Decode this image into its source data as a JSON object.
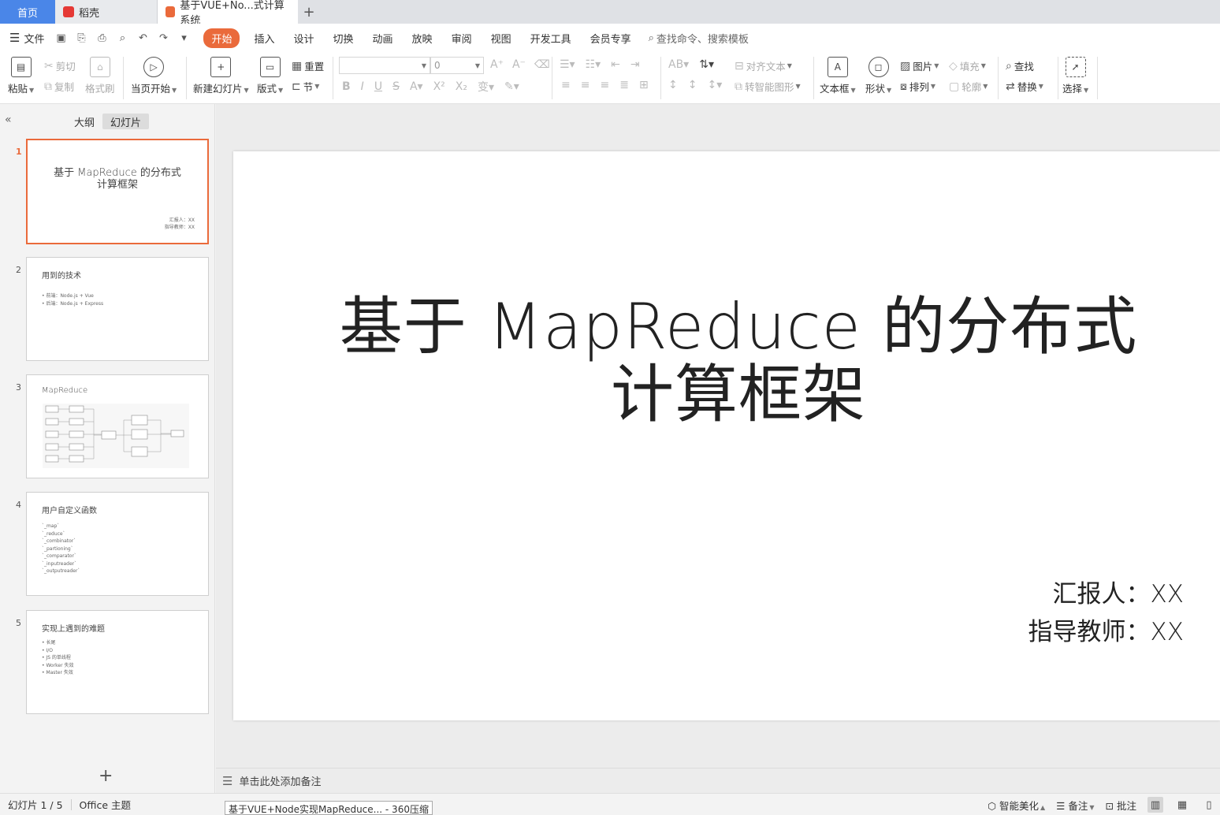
{
  "tabs": {
    "home": "首页",
    "daoke": "稻壳",
    "doc": "基于VUE+No...式计算系统",
    "plus": "+"
  },
  "menu": {
    "file": "文件",
    "items": [
      "开始",
      "插入",
      "设计",
      "切换",
      "动画",
      "放映",
      "审阅",
      "视图",
      "开发工具",
      "会员专享"
    ],
    "search": "查找命令、搜索模板"
  },
  "ribbon": {
    "paste": "粘贴",
    "cut": "剪切",
    "copy": "复制",
    "format_painter": "格式刷",
    "from_current": "当页开始",
    "new_slide": "新建幻灯片",
    "layout": "版式",
    "reset": "重置",
    "section": "节",
    "font_size": "0",
    "align_text": "对齐文本",
    "smart_graphic": "转智能图形",
    "text_box": "文本框",
    "shape": "形状",
    "picture": "图片",
    "fill": "填充",
    "arrange": "排列",
    "outline": "轮廓",
    "find": "查找",
    "replace": "替换",
    "select": "选择"
  },
  "left_panel": {
    "tab_outline": "大纲",
    "tab_slides": "幻灯片",
    "add": "+",
    "slides": [
      {
        "num": "1",
        "title_line1": "基于 MapReduce 的分布式",
        "title_line2": "计算框架",
        "sub1": "汇报人：XX",
        "sub2": "指导教师：XX"
      },
      {
        "num": "2",
        "title": "用到的技术",
        "bullets": [
          "• 前端：Node.js + Vue",
          "• 后端：Node.js + Express"
        ]
      },
      {
        "num": "3",
        "title": "MapReduce"
      },
      {
        "num": "4",
        "title": "用户自定义函数",
        "bullets": [
          "`_map`",
          "`_reduce`",
          "`_combinator`",
          "`_partioning`",
          "`_comparator`",
          "`_inputreader`",
          "`_outputreader`"
        ]
      },
      {
        "num": "5",
        "title": "实现上遇到的难题",
        "bullets": [
          "• 长尾",
          "• I/O",
          "• JS 的单线程",
          "• Worker 失效",
          "• Master 失效"
        ]
      }
    ]
  },
  "slide": {
    "title_line1": "基于 MapReduce 的分布式",
    "title_line2": "计算框架",
    "reporter": "汇报人：XX",
    "teacher": "指导教师：XX"
  },
  "notes": "单击此处添加备注",
  "status": {
    "slide_count": "幻灯片 1 / 5",
    "theme": "Office 主题",
    "task": "基于VUE+Node实现MapReduce... - 360压缩",
    "beautify": "智能美化",
    "notes": "备注",
    "comment": "批注"
  },
  "colors": {
    "accent": "#ea6a3b",
    "home_tab": "#4a86e8"
  }
}
